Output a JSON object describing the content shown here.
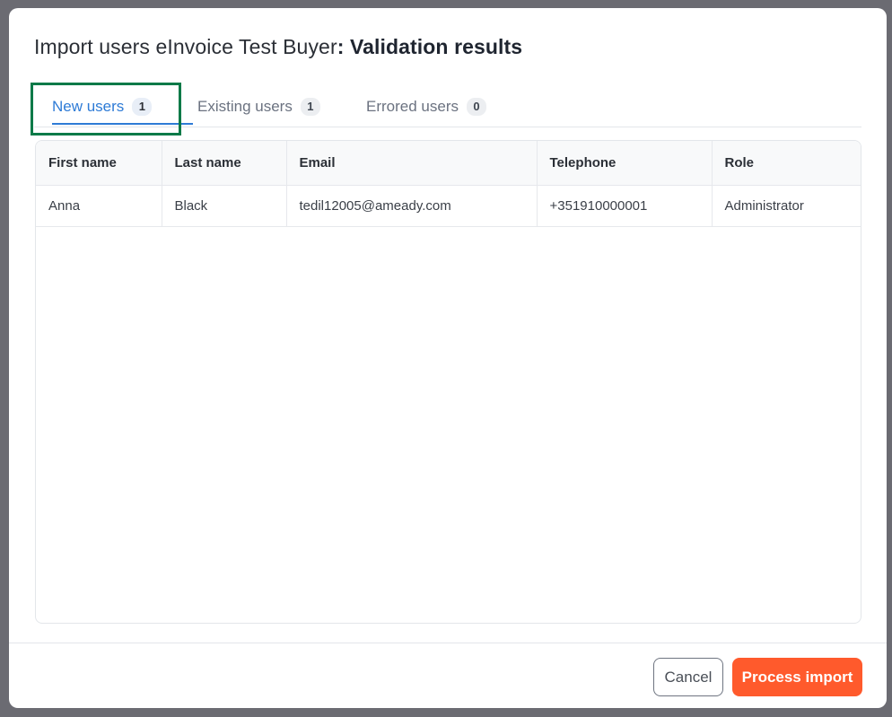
{
  "dialog": {
    "title_prefix": "Import users eInvoice Test Buyer",
    "title_emphasis": ": Validation results"
  },
  "tabs": [
    {
      "label": "New users",
      "count": "1",
      "active": true
    },
    {
      "label": "Existing users",
      "count": "1",
      "active": false
    },
    {
      "label": "Errored users",
      "count": "0",
      "active": false
    }
  ],
  "table": {
    "columns": [
      "First name",
      "Last name",
      "Email",
      "Telephone",
      "Role"
    ],
    "rows": [
      [
        "Anna",
        "Black",
        "tedil12005@ameady.com",
        "+351910000001",
        "Administrator"
      ]
    ]
  },
  "footer": {
    "cancel_label": "Cancel",
    "process_label": "Process import"
  },
  "colors": {
    "accent": "#2e7bd6",
    "primary_button": "#ff5a2c",
    "highlight": "#0b7a48"
  }
}
